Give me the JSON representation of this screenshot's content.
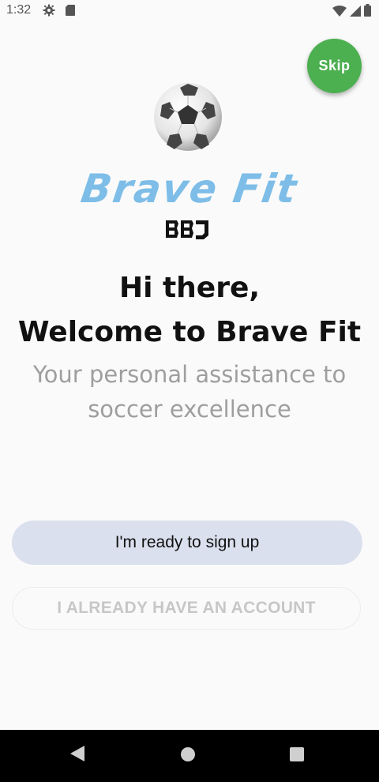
{
  "status_bar": {
    "time": "1:32",
    "icons": [
      "settings-gear-icon",
      "sd-card-icon",
      "wifi-icon",
      "cell-signal-icon",
      "battery-icon"
    ]
  },
  "skip": {
    "label": "Skip",
    "color": "#4caf50"
  },
  "brand": {
    "title": "Brave Fit",
    "title_color": "#7dbde8",
    "logo": "ball-icon"
  },
  "welcome": {
    "line1": "Hi there,",
    "line2": "Welcome to Brave Fit",
    "subtitle": "Your personal assistance to soccer excellence"
  },
  "actions": {
    "signup_label": "I'm ready to sign up",
    "signup_bg": "#dae0ed",
    "account_label": "I ALREADY HAVE AN ACCOUNT"
  },
  "nav_bar": {
    "icons": [
      "back-icon",
      "home-icon",
      "recents-icon"
    ]
  }
}
